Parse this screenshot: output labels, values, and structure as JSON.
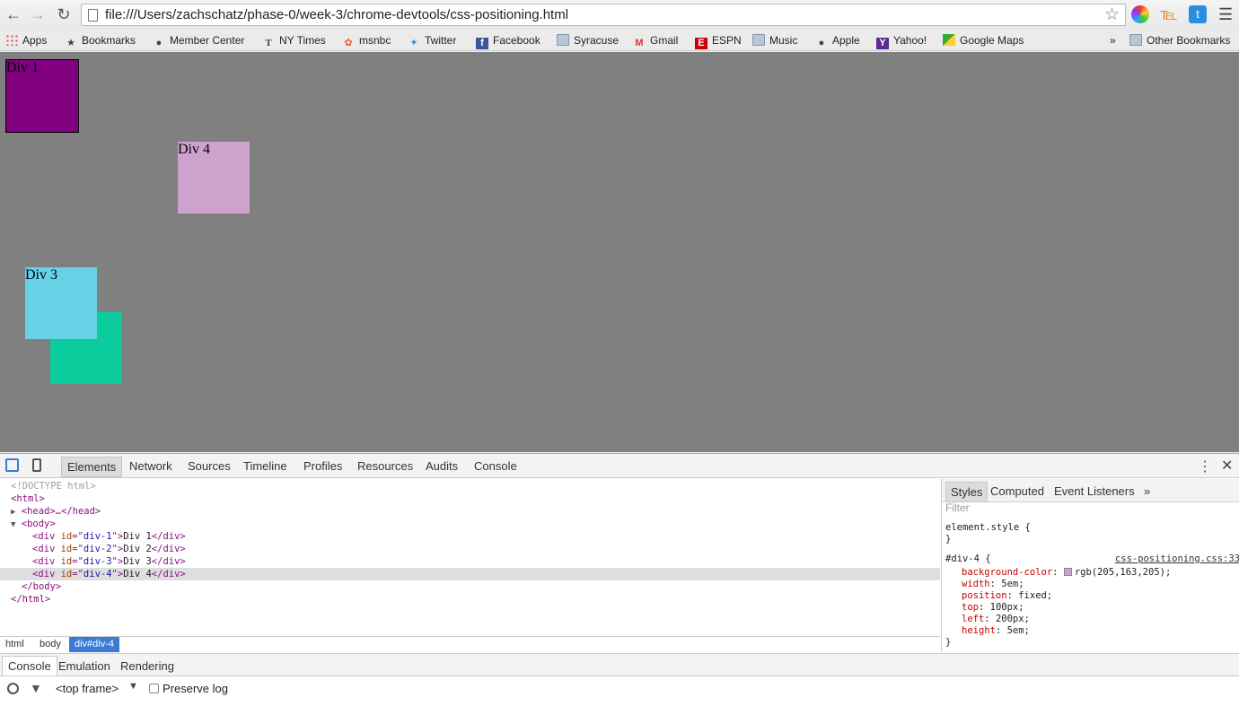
{
  "browser": {
    "url": "file:///Users/zachschatz/phase-0/week-3/chrome-devtools/css-positioning.html"
  },
  "bookmarks": [
    {
      "label": "Apps",
      "icon": "apps-icon"
    },
    {
      "label": "Bookmarks",
      "icon": "star-icon"
    },
    {
      "label": "Member Center",
      "icon": "apple-icon"
    },
    {
      "label": "NY Times",
      "icon": "nytimes-icon"
    },
    {
      "label": "msnbc",
      "icon": "nbc-icon"
    },
    {
      "label": "Twitter",
      "icon": "twitter-icon"
    },
    {
      "label": "Facebook",
      "icon": "facebook-icon"
    },
    {
      "label": "Syracuse",
      "icon": "folder-icon"
    },
    {
      "label": "Gmail",
      "icon": "gmail-icon"
    },
    {
      "label": "ESPN",
      "icon": "espn-icon"
    },
    {
      "label": "Music",
      "icon": "folder-icon"
    },
    {
      "label": "Apple",
      "icon": "apple-icon"
    },
    {
      "label": "Yahoo!",
      "icon": "yahoo-icon"
    },
    {
      "label": "Google Maps",
      "icon": "maps-icon"
    }
  ],
  "bookmarks_overflow": "»",
  "other_bookmarks": "Other Bookmarks",
  "page": {
    "div1": "Div 1",
    "div3": "Div 3",
    "div4": "Div 4",
    "background": "#808080",
    "colors": {
      "div1": "#800080",
      "div2": "#0acc9c",
      "div3": "#66d2e8",
      "div4": "#cda3cd"
    }
  },
  "devtools": {
    "tabs": [
      "Elements",
      "Network",
      "Sources",
      "Timeline",
      "Profiles",
      "Resources",
      "Audits",
      "Console"
    ],
    "active_tab": "Elements",
    "dom": {
      "doctype": "<!DOCTYPE html>",
      "html_open": "<html>",
      "head": "<head>…</head>",
      "body_open": "<body>",
      "divs": [
        {
          "id": "div-1",
          "text": "Div 1"
        },
        {
          "id": "div-2",
          "text": "Div 2"
        },
        {
          "id": "div-3",
          "text": "Div 3"
        },
        {
          "id": "div-4",
          "text": "Div 4"
        }
      ],
      "body_close": "</body>",
      "html_close": "</html>"
    },
    "breadcrumbs": [
      "html",
      "body",
      "div#div-4"
    ],
    "styles_tabs": [
      "Styles",
      "Computed",
      "Event Listeners",
      "»"
    ],
    "filter_placeholder": "Filter",
    "element_style": "element.style {",
    "close_brace": "}",
    "rule": {
      "selector": "#div-4 {",
      "source": "css-positioning.css:33",
      "props": [
        {
          "name": "background-color",
          "value": "rgb(205,163,205);",
          "swatch": "#cda3cd"
        },
        {
          "name": "width",
          "value": "5em;"
        },
        {
          "name": "position",
          "value": "fixed;"
        },
        {
          "name": "top",
          "value": "100px;"
        },
        {
          "name": "left",
          "value": "200px;"
        },
        {
          "name": "height",
          "value": "5em;"
        }
      ]
    },
    "drawer_tabs": [
      "Console",
      "Emulation",
      "Rendering"
    ],
    "console": {
      "frame": "<top frame>",
      "preserve_log": "Preserve log"
    }
  }
}
